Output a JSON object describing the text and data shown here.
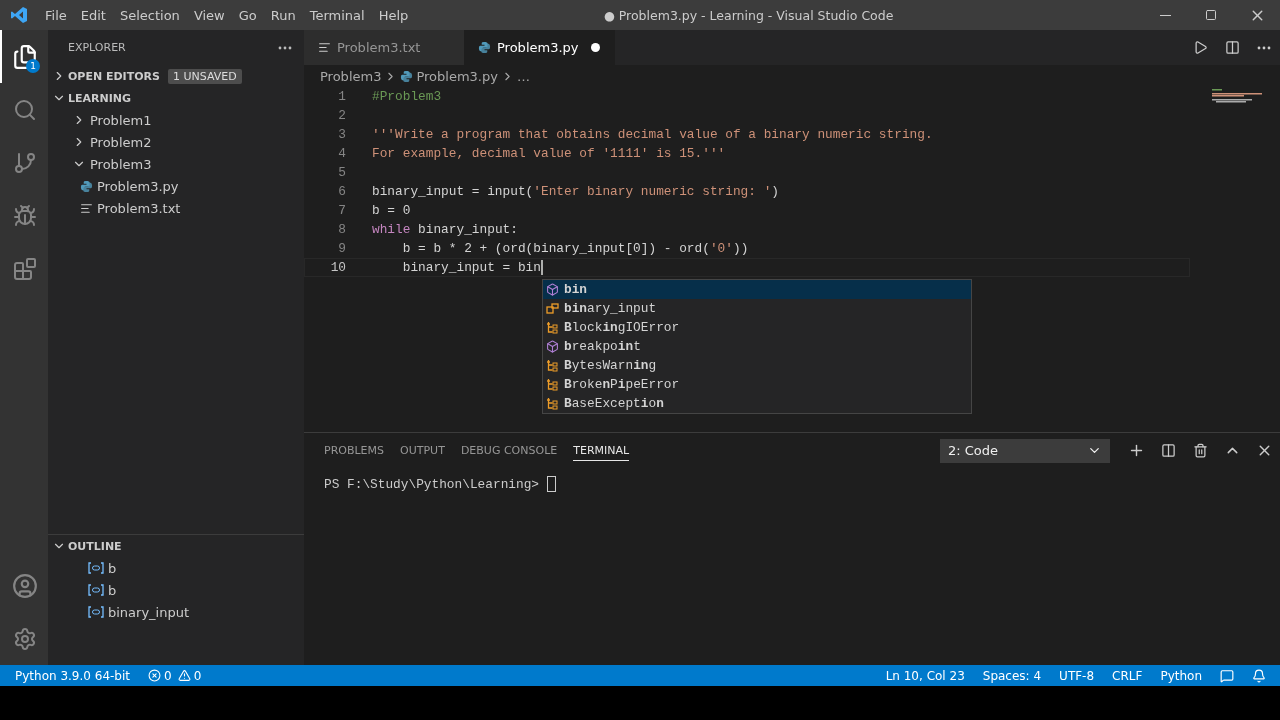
{
  "menu": [
    "File",
    "Edit",
    "Selection",
    "View",
    "Go",
    "Run",
    "Terminal",
    "Help"
  ],
  "window": {
    "title": "● Problem3.py - Learning - Visual Studio Code"
  },
  "activity": {
    "badge": "1"
  },
  "sidebar": {
    "title": "EXPLORER",
    "sections": [
      {
        "label": "OPEN EDITORS",
        "expanded": false,
        "badge": "1 UNSAVED"
      },
      {
        "label": "LEARNING",
        "expanded": true,
        "tree": [
          {
            "label": "Problem1",
            "kind": "folder",
            "expanded": false
          },
          {
            "label": "Problem2",
            "kind": "folder",
            "expanded": false
          },
          {
            "label": "Problem3",
            "kind": "folder",
            "expanded": true,
            "children": [
              {
                "label": "Problem3.py",
                "kind": "python"
              },
              {
                "label": "Problem3.txt",
                "kind": "text"
              }
            ]
          }
        ]
      }
    ],
    "outline": {
      "label": "OUTLINE",
      "expanded": true,
      "items": [
        "b",
        "b",
        "binary_input"
      ]
    }
  },
  "tabs": [
    {
      "label": "Problem3.txt",
      "kind": "text",
      "selected": false,
      "dirty": false
    },
    {
      "label": "Problem3.py",
      "kind": "python",
      "selected": true,
      "dirty": true
    }
  ],
  "breadcrumbs": {
    "folder": "Problem3",
    "file": "Problem3.py",
    "more": "…"
  },
  "code": [
    {
      "n": "1",
      "current": false,
      "tokens": [
        {
          "text": "#Problem3",
          "color": "#6a9955"
        }
      ]
    },
    {
      "n": "2",
      "current": false
    },
    {
      "n": "3",
      "current": false,
      "tokens": [
        {
          "text": "'''Write a program that obtains decimal value of a binary numeric string.",
          "color": "#ce9178"
        }
      ]
    },
    {
      "n": "4",
      "current": false,
      "tokens": [
        {
          "text": "For example, decimal value of '1111' is 15.'''",
          "color": "#ce9178"
        }
      ]
    },
    {
      "n": "5",
      "current": false
    },
    {
      "n": "6",
      "current": false,
      "tokens": [
        {
          "text": "binary_input = input("
        },
        {
          "text": "'Enter binary numeric string: '",
          "color": "#ce9178"
        },
        {
          "text": ")"
        }
      ]
    },
    {
      "n": "7",
      "current": false,
      "tokens": [
        {
          "text": "b = 0"
        }
      ]
    },
    {
      "n": "8",
      "current": false,
      "tokens": [
        {
          "text": "while",
          "color": "#c586c0"
        },
        {
          "text": " binary_input:"
        }
      ]
    },
    {
      "n": "9",
      "current": false,
      "tokens": [
        {
          "text": "    b = b * 2 + (ord(binary_input[0]) - ord("
        },
        {
          "text": "'0'",
          "color": "#ce9178"
        },
        {
          "text": "))"
        }
      ]
    },
    {
      "n": "10",
      "current": true,
      "tokens": [
        {
          "text": "    binary_input = bin"
        }
      ]
    }
  ],
  "suggestions": [
    {
      "kind": "function",
      "selected": true,
      "label": "**bin**"
    },
    {
      "kind": "variable",
      "selected": false,
      "label": "**bin**ary_input"
    },
    {
      "kind": "class",
      "selected": false,
      "label": "**B**lock**in**gIOError"
    },
    {
      "kind": "function",
      "selected": false,
      "label": "**b**reakpo**in**t"
    },
    {
      "kind": "class",
      "selected": false,
      "label": "**B**ytesWarn**in**g"
    },
    {
      "kind": "class",
      "selected": false,
      "label": "**B**roke**n**P**i**peError"
    },
    {
      "kind": "class",
      "selected": false,
      "label": "**B**aseExcept**i**o**n**"
    }
  ],
  "panel": {
    "tabs": [
      {
        "label": "PROBLEMS",
        "selected": false
      },
      {
        "label": "OUTPUT",
        "selected": false
      },
      {
        "label": "DEBUG CONSOLE",
        "selected": false
      },
      {
        "label": "TERMINAL",
        "selected": true
      }
    ],
    "terminal_select": "2: Code",
    "prompt": "PS F:\\Study\\Python\\Learning> "
  },
  "status_bar": {
    "interpreter": "Python 3.9.0 64-bit",
    "errors": "0",
    "warnings": "0",
    "right": [
      "Ln 10, Col 23",
      "Spaces: 4",
      "UTF-8",
      "CRLF",
      "Python"
    ]
  }
}
